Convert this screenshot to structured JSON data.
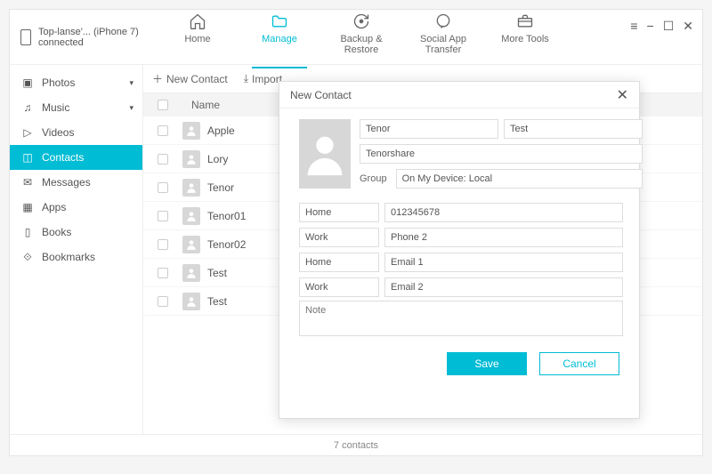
{
  "device": {
    "name": "Top-lanse'... (iPhone 7)",
    "status": "connected"
  },
  "tabs": [
    {
      "label": "Home"
    },
    {
      "label": "Manage"
    },
    {
      "label": "Backup & Restore"
    },
    {
      "label": "Social App Transfer"
    },
    {
      "label": "More Tools"
    }
  ],
  "sidebar": [
    {
      "label": "Photos",
      "expandable": true
    },
    {
      "label": "Music",
      "expandable": true
    },
    {
      "label": "Videos"
    },
    {
      "label": "Contacts"
    },
    {
      "label": "Messages"
    },
    {
      "label": "Apps"
    },
    {
      "label": "Books"
    },
    {
      "label": "Bookmarks"
    }
  ],
  "toolbar": {
    "new": "New Contact",
    "import": "Import"
  },
  "list": {
    "header": "Name",
    "rows": [
      "Apple",
      "Lory",
      "Tenor",
      "Tenor01",
      "Tenor02",
      "Test",
      "Test"
    ]
  },
  "footer": "7 contacts",
  "dialog": {
    "title": "New Contact",
    "first": "Tenor",
    "last": "Test",
    "company": "Tenorshare",
    "group_label": "Group",
    "group_value": "On My Device: Local",
    "fields": [
      {
        "k": "Home",
        "v": "012345678"
      },
      {
        "k": "Work",
        "v": "Phone 2"
      },
      {
        "k": "Home",
        "v": "Email 1"
      },
      {
        "k": "Work",
        "v": "Email 2"
      }
    ],
    "note_ph": "Note",
    "save": "Save",
    "cancel": "Cancel"
  }
}
